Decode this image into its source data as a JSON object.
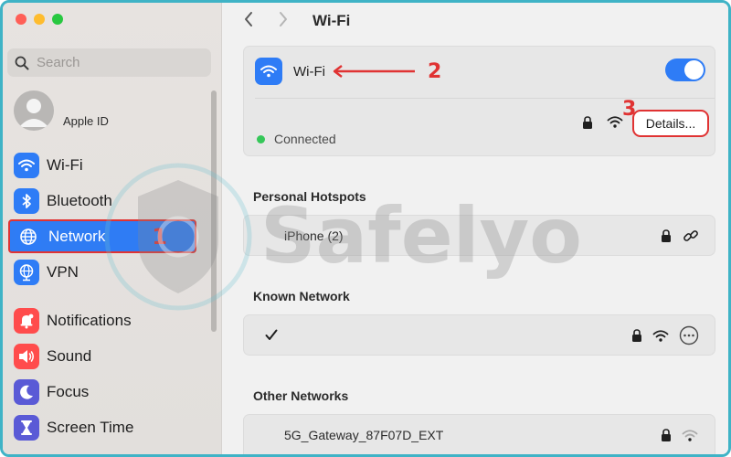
{
  "window": {
    "traffic_colors": [
      "#ff5f57",
      "#febc2e",
      "#28c840"
    ]
  },
  "sidebar": {
    "search_placeholder": "Search",
    "apple_id_label": "Apple ID",
    "items": [
      {
        "label": "Wi-Fi",
        "icon": "wifi-icon",
        "color": "#2e7cf6"
      },
      {
        "label": "Bluetooth",
        "icon": "bluetooth-icon",
        "color": "#2e7cf6"
      },
      {
        "label": "Network",
        "icon": "globe-icon",
        "color": "#2e7cf6",
        "active": true
      },
      {
        "label": "VPN",
        "icon": "vpn-globe-icon",
        "color": "#2e7cf6"
      },
      {
        "label": "Notifications",
        "icon": "bell-icon",
        "color": "#ff4c4c"
      },
      {
        "label": "Sound",
        "icon": "speaker-icon",
        "color": "#ff4c4c"
      },
      {
        "label": "Focus",
        "icon": "moon-icon",
        "color": "#5a5ad6"
      },
      {
        "label": "Screen Time",
        "icon": "hourglass-icon",
        "color": "#5a5ad6"
      }
    ]
  },
  "main": {
    "title": "Wi-Fi",
    "wifi": {
      "name": "Wi-Fi",
      "status": "Connected",
      "details_label": "Details...",
      "enabled": true
    },
    "sections": {
      "personal_hotspots": "Personal Hotspots",
      "known_network": "Known Network",
      "other_networks": "Other Networks"
    },
    "hotspots": [
      {
        "name": "iPhone (2)"
      }
    ],
    "known": [
      {
        "name": "",
        "checked": true
      }
    ],
    "others": [
      {
        "name": "5G_Gateway_87F07D_EXT"
      }
    ]
  },
  "annotations": {
    "one": "1",
    "two": "2",
    "three": "3",
    "color": "#e03333"
  },
  "watermark": {
    "text": "Safelyo"
  }
}
